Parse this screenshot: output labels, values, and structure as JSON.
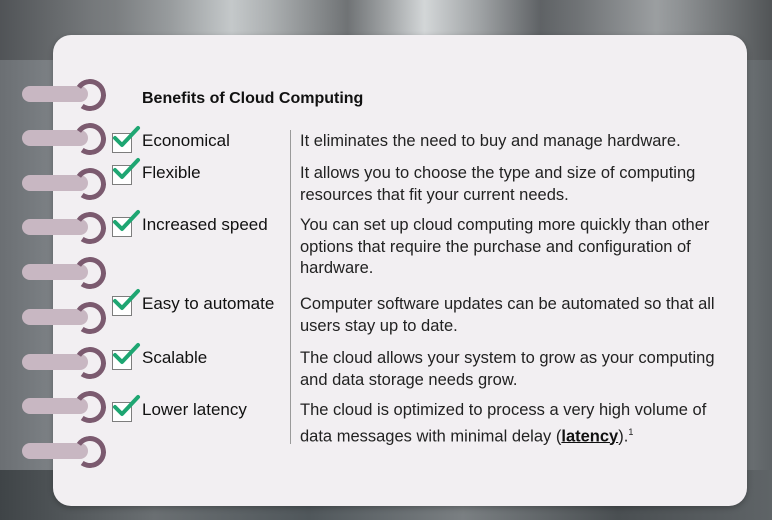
{
  "title": "Benefits of Cloud Computing",
  "benefits": [
    {
      "label": "Economical",
      "description": "It eliminates the need to buy and manage hardware."
    },
    {
      "label": "Flexible",
      "description": "It allows you to choose the type and size of computing resources that fit your current needs."
    },
    {
      "label": "Increased speed",
      "description": "You can set up cloud computing more quickly than other options that require the purchase and configuration of hardware."
    },
    {
      "label": "Easy to automate",
      "description": "Computer software updates can be automated so that all users stay up to date."
    },
    {
      "label": "Scalable",
      "description": "The cloud allows your system to grow as your computing and data storage needs grow."
    },
    {
      "label": "Lower latency",
      "description_prefix": "The cloud is optimized to process a very high volume of data messages with minimal delay (",
      "term": "latency",
      "description_suffix": ").",
      "footnote": "1"
    }
  ],
  "colors": {
    "card": "#f2eff2",
    "check": "#1ea672",
    "ring_bar": "#c8b7c2",
    "ring_hook": "#7b5a6f"
  },
  "icons": {
    "check": "checkmark-icon",
    "ring": "spiral-binding-icon"
  }
}
